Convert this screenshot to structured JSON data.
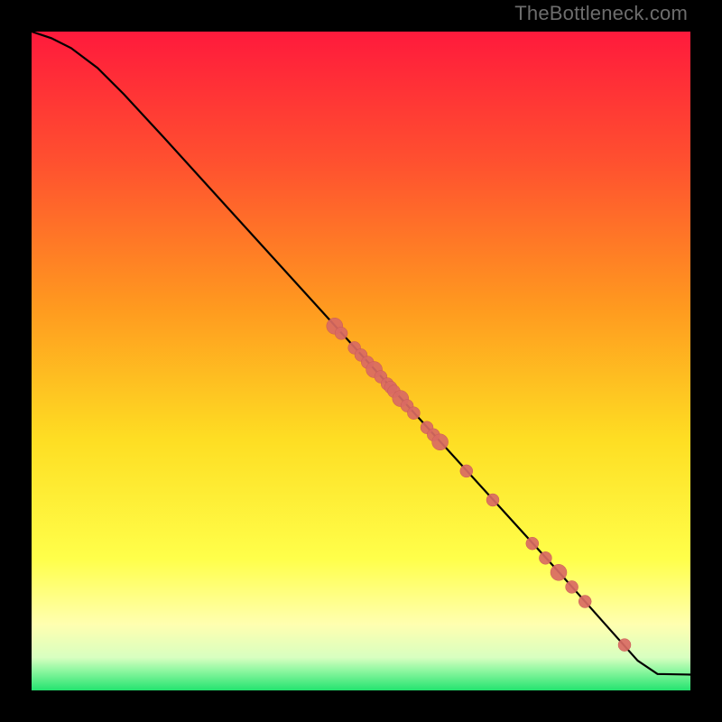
{
  "watermark": "TheBottleneck.com",
  "colors": {
    "background_top": "#ff1a3c",
    "background_mid1": "#ff6a2f",
    "background_mid2": "#fede23",
    "background_low1": "#ffff7a",
    "background_low2": "#f3ffd6",
    "background_bottom": "#24e36f",
    "curve": "#000000",
    "point_fill": "#d96a63",
    "point_stroke": "#c95a55"
  },
  "chart_data": {
    "type": "line",
    "title": "",
    "xlabel": "",
    "ylabel": "",
    "xlim": [
      0,
      100
    ],
    "ylim": [
      0,
      100
    ],
    "x": [
      0,
      3,
      6,
      10,
      14,
      20,
      30,
      40,
      50,
      60,
      70,
      80,
      88,
      92,
      95,
      100
    ],
    "y": [
      100,
      99,
      97.5,
      94.5,
      90.5,
      84,
      73,
      62,
      51,
      40,
      29,
      18,
      9,
      4.5,
      2.5,
      2.4
    ],
    "overlay_points": {
      "type": "scatter",
      "x": [
        46,
        47,
        49,
        50,
        51,
        52,
        53,
        54,
        54.5,
        55,
        56,
        57,
        58,
        60,
        61,
        62,
        66,
        70,
        76,
        78,
        80,
        82,
        84,
        90
      ],
      "y": [
        55.3,
        54.2,
        52,
        50.9,
        49.8,
        48.7,
        47.6,
        46.5,
        46,
        45.4,
        44.3,
        43.2,
        42.1,
        39.9,
        38.8,
        37.7,
        33.3,
        28.9,
        22.3,
        20.1,
        17.9,
        15.7,
        13.5,
        6.9
      ]
    }
  }
}
